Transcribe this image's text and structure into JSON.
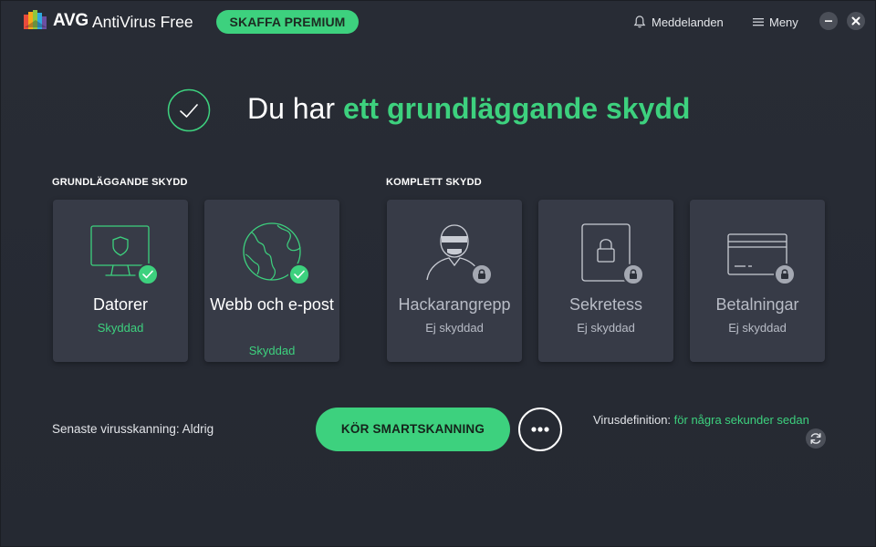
{
  "titlebar": {
    "brand": "AVG",
    "product": "AntiVirus Free",
    "premium_label": "SKAFFA PREMIUM",
    "notifications_label": "Meddelanden",
    "menu_label": "Meny"
  },
  "hero": {
    "title_prefix": "Du har ",
    "title_highlight": "ett grundläggande skydd"
  },
  "sections": {
    "basic_label": "GRUNDLÄGGANDE SKYDD",
    "complete_label": "KOMPLETT SKYDD"
  },
  "cards": [
    {
      "title": "Datorer",
      "status": "Skyddad",
      "icon": "monitor-shield-icon",
      "protected": true
    },
    {
      "title": "Webb och e-post",
      "status": "Skyddad",
      "icon": "globe-icon",
      "protected": true
    },
    {
      "title": "Hackarangrepp",
      "status": "Ej skyddad",
      "icon": "hacker-icon",
      "protected": false
    },
    {
      "title": "Sekretess",
      "status": "Ej skyddad",
      "icon": "padlock-icon",
      "protected": false
    },
    {
      "title": "Betalningar",
      "status": "Ej skyddad",
      "icon": "credit-card-icon",
      "protected": false
    }
  ],
  "footer": {
    "last_scan": "Senaste virusskanning: Aldrig",
    "scan_button": "KÖR SMARTSKANNING",
    "virus_def_label": "Virusdefinition: ",
    "virus_def_value": "för några sekunder sedan"
  },
  "colors": {
    "accent": "#3dd17e",
    "background": "#262a33",
    "card": "#373b47"
  }
}
